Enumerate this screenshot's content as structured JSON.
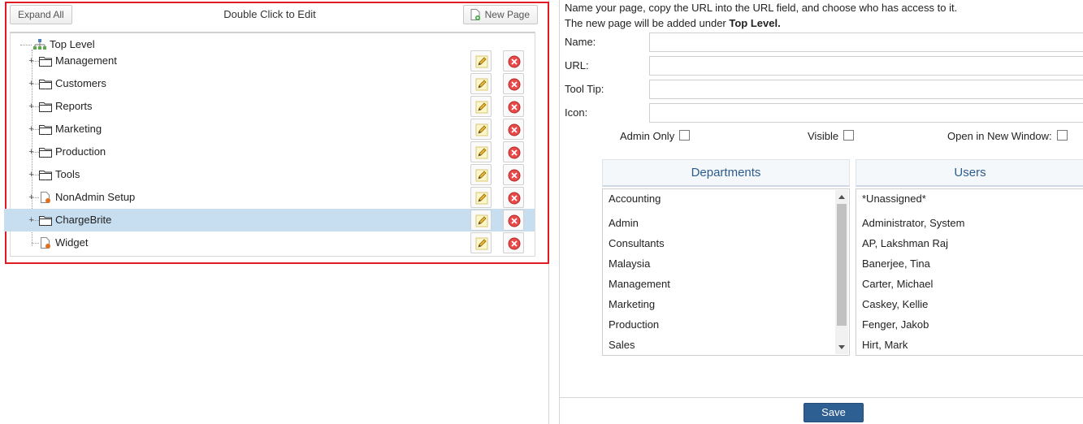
{
  "toolbar": {
    "expand_all_label": "Expand All",
    "title": "Double Click to Edit",
    "new_page_label": "New Page"
  },
  "tree": {
    "root_label": "Top Level",
    "nodes": [
      {
        "label": "Management",
        "type": "folder",
        "expandable": true,
        "selected": false
      },
      {
        "label": "Customers",
        "type": "folder",
        "expandable": true,
        "selected": false
      },
      {
        "label": "Reports",
        "type": "folder",
        "expandable": true,
        "selected": false
      },
      {
        "label": "Marketing",
        "type": "folder",
        "expandable": true,
        "selected": false
      },
      {
        "label": "Production",
        "type": "folder",
        "expandable": true,
        "selected": false
      },
      {
        "label": "Tools",
        "type": "folder",
        "expandable": true,
        "selected": false
      },
      {
        "label": "NonAdmin Setup",
        "type": "page",
        "expandable": true,
        "selected": false
      },
      {
        "label": "ChargeBrite",
        "type": "folder",
        "expandable": true,
        "selected": true
      },
      {
        "label": "Widget",
        "type": "page",
        "expandable": false,
        "selected": false
      }
    ]
  },
  "form": {
    "instructions_line1": "Name your page, copy the URL into the URL field, and choose who has access to it.",
    "instructions_line2_prefix": "The new page will be added under ",
    "instructions_line2_target": "Top Level.",
    "name_label": "Name:",
    "name_value": "",
    "url_label": "URL:",
    "url_value": "",
    "tooltip_label": "Tool Tip:",
    "tooltip_value": "",
    "icon_label": "Icon:",
    "icon_value": "",
    "admin_only_label": "Admin Only",
    "admin_only_checked": false,
    "visible_label": "Visible",
    "visible_checked": false,
    "new_window_label": "Open in New Window:",
    "new_window_checked": false
  },
  "departments": {
    "header": "Departments",
    "items": [
      "Accounting",
      "Admin",
      "Consultants",
      "Malaysia",
      "Management",
      "Marketing",
      "Production",
      "Sales"
    ]
  },
  "users": {
    "header": "Users",
    "items": [
      "*Unassigned*",
      "Administrator, System",
      "AP, Lakshman Raj",
      "Banerjee, Tina",
      "Carter, Michael",
      "Caskey, Kellie",
      "Fenger, Jakob",
      "Hirt, Mark"
    ]
  },
  "save_label": "Save",
  "colors": {
    "highlight_frame": "#e01b24",
    "selected_row": "#c7ddf0",
    "save_button": "#2e5f93",
    "list_header_text": "#2c5c8c"
  }
}
